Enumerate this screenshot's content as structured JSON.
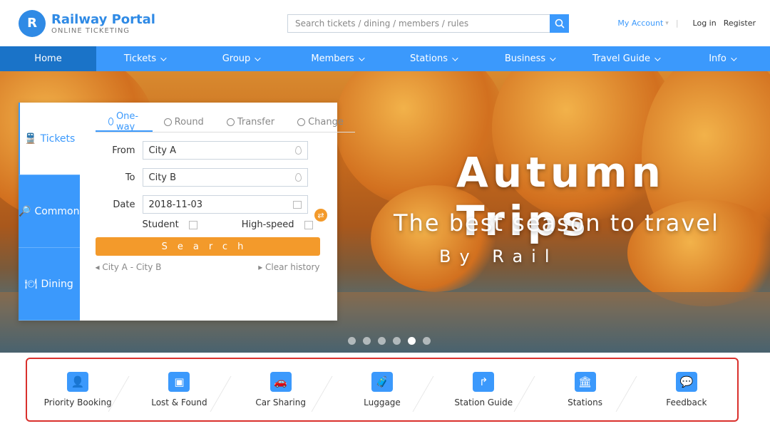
{
  "brand": {
    "name": "Railway Portal",
    "sub": "ONLINE TICKETING",
    "mark": "R"
  },
  "search": {
    "placeholder": "Search tickets / dining / members / rules"
  },
  "user": {
    "account": "My Account",
    "login": "Log in",
    "register": "Register"
  },
  "nav": [
    {
      "label": "Home",
      "active": true
    },
    {
      "label": "Tickets"
    },
    {
      "label": "Group"
    },
    {
      "label": "Members"
    },
    {
      "label": "Stations"
    },
    {
      "label": "Business"
    },
    {
      "label": "Travel Guide"
    },
    {
      "label": "Info"
    }
  ],
  "promo": {
    "title": "Autumn Trips",
    "sub": "The best season to travel",
    "sub2": "By Rail"
  },
  "card": {
    "tabs": [
      "Tickets",
      "Common",
      "Dining"
    ],
    "trip_tabs": [
      "One-way",
      "Round",
      "Transfer",
      "Change"
    ],
    "from_label": "From",
    "from_value": "City A",
    "to_label": "To",
    "to_value": "City B",
    "date_label": "Date",
    "date_value": "2018-11-03",
    "student_label": "Student",
    "highspeed_label": "High-speed",
    "query_label": "Search",
    "history_item": "◂ City A - City B",
    "history_clear": "▸ Clear history"
  },
  "carousel": {
    "count": 6,
    "active_index": 4
  },
  "services": [
    {
      "label": "Priority Booking",
      "icon": "👤"
    },
    {
      "label": "Lost & Found",
      "icon": "▣"
    },
    {
      "label": "Car Sharing",
      "icon": "🚗"
    },
    {
      "label": "Luggage",
      "icon": "🧳"
    },
    {
      "label": "Station Guide",
      "icon": "↱"
    },
    {
      "label": "Stations",
      "icon": "🏛"
    },
    {
      "label": "Feedback",
      "icon": "💬"
    }
  ],
  "colors": {
    "primary": "#3b99fc",
    "accent": "#f39a2b",
    "highlight": "#d9302c"
  }
}
